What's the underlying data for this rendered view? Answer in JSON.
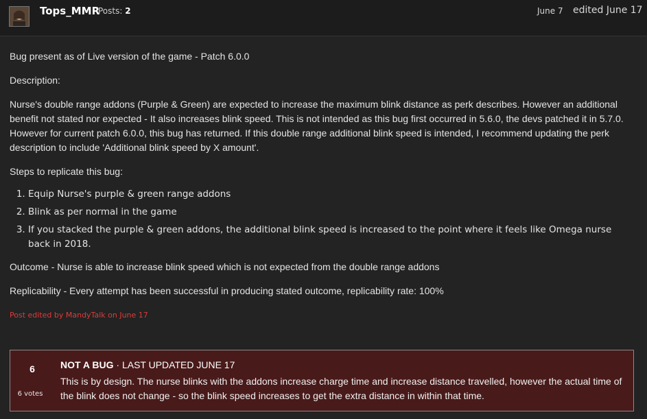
{
  "post": {
    "author": "Tops_MMR",
    "posts_label": "Posts:",
    "posts_count": "2",
    "date": "June 7",
    "edited": "edited June 17",
    "paragraphs": {
      "p1": "Bug present as of Live version of the game - Patch 6.0.0",
      "p2": "Description:",
      "p3": "Nurse's double range addons (Purple & Green) are expected to increase the maximum blink distance as perk describes. However an additional benefit not stated nor expected - It also increases blink speed. This is not intended as this bug first occurred in 5.6.0, the devs patched it in 5.7.0. However for current patch 6.0.0, this bug has returned. If this double range additional blink speed is intended, I recommend updating the perk description to include 'Additional blink speed by X amount'.",
      "p4": "Steps to replicate this bug:",
      "p5": "Outcome - Nurse is able to increase blink speed which is not expected from the double range addons",
      "p6": "Replicability - Every attempt has been successful in producing stated outcome, replicability rate: 100%"
    },
    "steps": [
      "Equip Nurse's purple & green range addons",
      "Blink as per normal in the game",
      "If you stacked the purple & green addons, the additional blink speed is increased to the point where it feels like Omega nurse back in 2018."
    ],
    "edit_note": "Post edited by MandyTalk on June 17"
  },
  "status": {
    "votes": "6",
    "votes_label": "6 votes",
    "label": "NOT A BUG",
    "updated": " · LAST UPDATED JUNE 17",
    "text": "This is by design. The nurse blinks with the addons increase charge time and increase distance travelled, however the actual time of the blink does not change - so the blink speed increases to get the extra distance in within that time."
  },
  "colors": {
    "page_bg": "#232323",
    "status_bg": "#491a1a",
    "edit_note": "#e03a3a"
  }
}
